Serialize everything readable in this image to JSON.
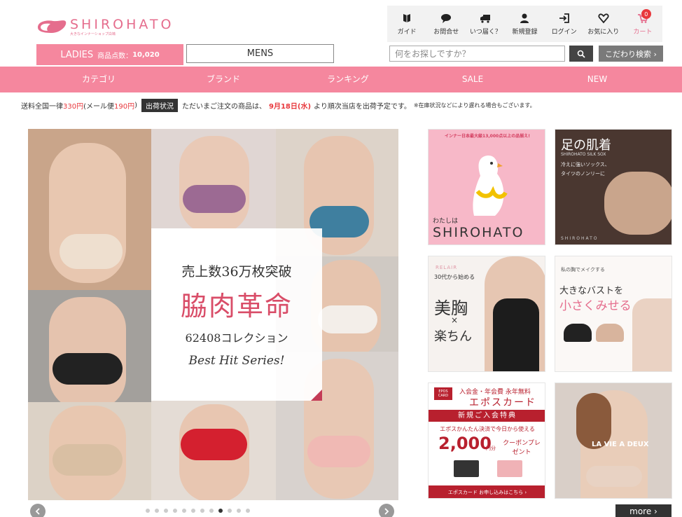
{
  "header": {
    "logo_name": "SHIROHATO",
    "logo_sub": "大きなインナーショップ白鳩",
    "icons": [
      {
        "label": "ガイド",
        "icon": "guide-icon"
      },
      {
        "label": "お問合せ",
        "icon": "chat-icon"
      },
      {
        "label": "いつ届く？",
        "icon": "truck-icon"
      },
      {
        "label": "新規登録",
        "icon": "user-icon"
      },
      {
        "label": "ログイン",
        "icon": "login-icon"
      },
      {
        "label": "お気に入り",
        "icon": "heart-icon"
      },
      {
        "label": "カート",
        "icon": "cart-icon"
      }
    ],
    "cart_count": "0"
  },
  "tabs": {
    "ladies": "LADIES",
    "ladies_count_label": "商品点数：",
    "ladies_count": "10,020",
    "mens": "MENS"
  },
  "search": {
    "placeholder": "何をお探しですか？",
    "advanced": "こだわり検索 ›"
  },
  "nav": [
    "カテゴリ",
    "ブランド",
    "ランキング",
    "SALE",
    "NEW"
  ],
  "notice": {
    "p1": "送料全国一律",
    "price1": "330円",
    "p2": "(メール便",
    "price2": "190円",
    "p3": ")",
    "badge": "出荷状況",
    "p4": "ただいまご注文の商品は、",
    "date": "9月18日(水)",
    "p5": "より順次当店を出荷予定です。",
    "small": "※在庫状況などにより遅れる場合もございます。"
  },
  "hero": {
    "line1": "売上数36万枚突破",
    "line2": "脇肉革命",
    "line3": "62408コレクション",
    "line4": "Best Hit Series!"
  },
  "banners": {
    "b1_top": "インナー日本最大級13,000点以上の品揃え!",
    "b1_sub": "わたしは",
    "b1_main": "SHIROHATO",
    "b2_title": "足の肌着",
    "b2_sub": "SHIROHATO SILK SOX",
    "b2_text": "冷えに強いソックス、タイツのノンリーに",
    "b2_foot": "SHIROHATO",
    "b3_brand": "RELAIR",
    "b3_a": "30代から始める",
    "b3_b": "美胸",
    "b3_c": "×",
    "b3_d": "楽ちん",
    "b4_a": "私の胸でメイクする",
    "b4_b": "大きなバストを",
    "b4_c": "小さくみせる",
    "b5_logo": "EPOS CARD",
    "b5_head": "入会金・年会費 永年無料",
    "b5_name": "エポスカード",
    "b5_red": "新規ご入会特典",
    "b5_line": "エポスかんたん決済で今日から使える",
    "b5_amount": "2,000",
    "b5_unit": "円分",
    "b5_coupon": "クーポンプレゼント",
    "b5_foot": "エポスカード お申し込みはこちら ›",
    "b6_text": "LA VIE A DEUX"
  },
  "more_label": "more ›",
  "colors": {
    "accent": "#f5879e",
    "dark": "#333333",
    "red": "#e8383d"
  }
}
